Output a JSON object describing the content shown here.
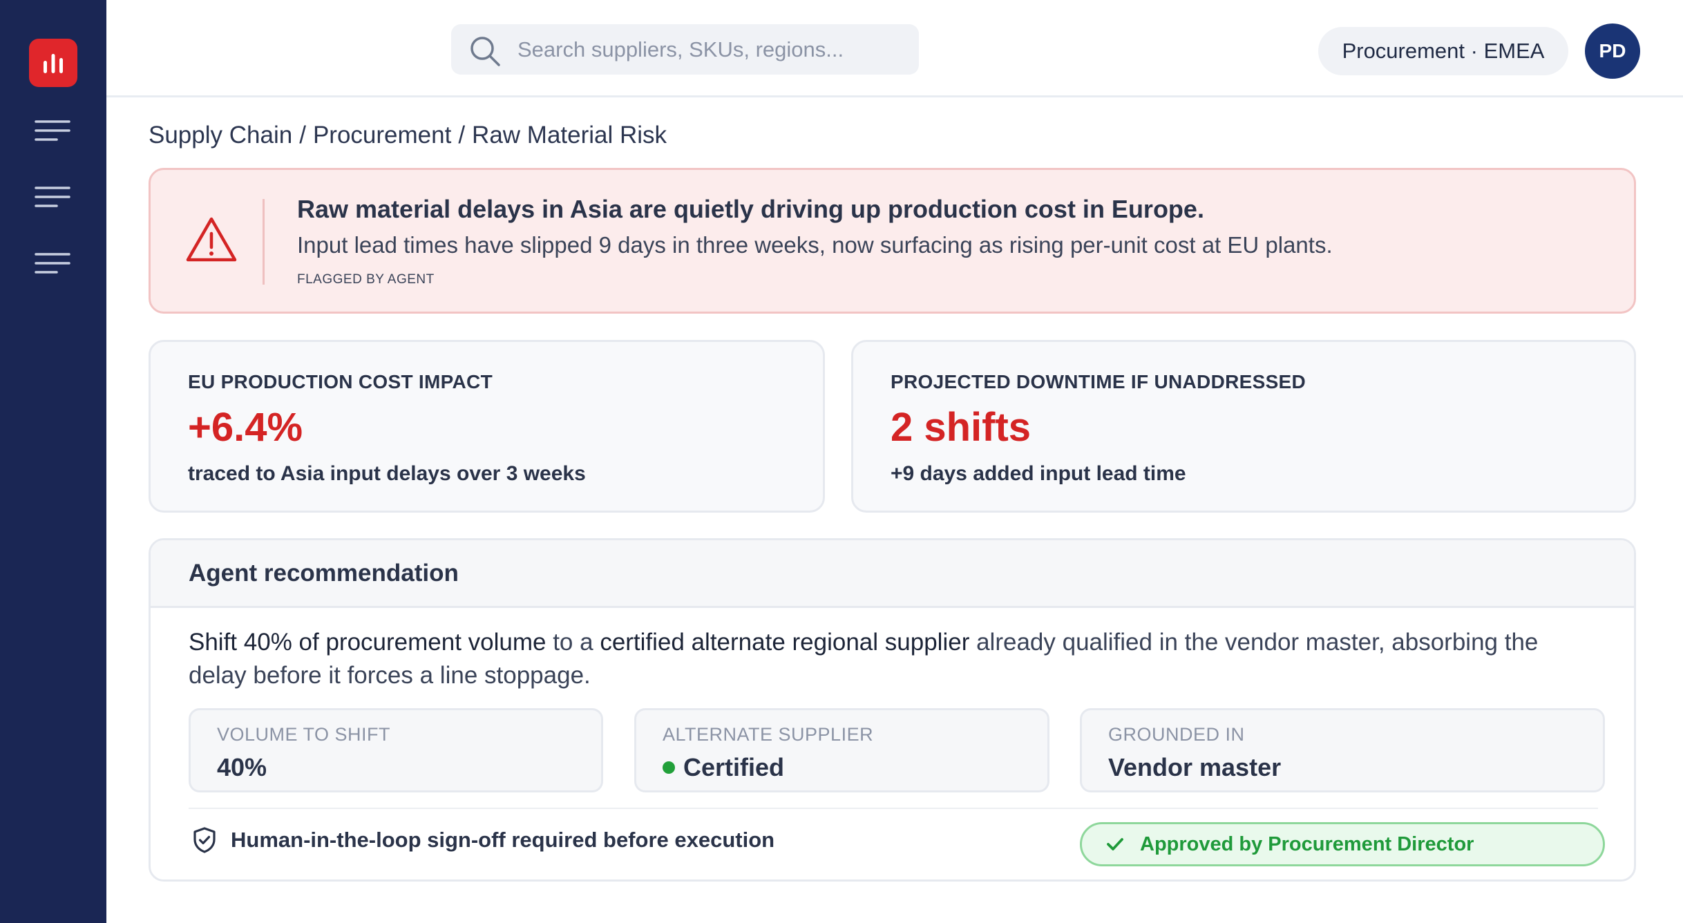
{
  "sidebar": {
    "logo": "bar-chart-icon",
    "nav_icons": [
      "menu-icon",
      "menu-icon",
      "menu-icon"
    ]
  },
  "topbar": {
    "search_placeholder": "Search suppliers, SKUs, regions...",
    "workspace": "Procurement · EMEA",
    "avatar_initials": "PD"
  },
  "breadcrumb": {
    "items": [
      "Supply Chain",
      "Procurement",
      "Raw Material Risk"
    ],
    "separator": "/"
  },
  "alert": {
    "title": "Raw material delays in Asia are quietly driving up production cost in Europe.",
    "subtitle": "Input lead times have slipped 9 days in three weeks, now surfacing as rising per-unit cost at EU plants.",
    "tag": "FLAGGED BY AGENT",
    "icon": "warning-triangle-icon"
  },
  "kpis": [
    {
      "label": "EU PRODUCTION COST IMPACT",
      "value": "+6.4%",
      "note": "traced to Asia input delays over 3 weeks"
    },
    {
      "label": "PROJECTED DOWNTIME IF UNADDRESSED",
      "value": "2 shifts",
      "note": "+9 days added input lead time"
    }
  ],
  "recommendation": {
    "title": "Agent recommendation",
    "body": {
      "p1": "Shift 40% of procurement volume",
      "p2": " to a ",
      "p3": "certified alternate regional supplier",
      "p4": " already qualified in the vendor master, absorbing the delay before it forces a line stoppage."
    },
    "chips": [
      {
        "label": "VOLUME TO SHIFT",
        "value": "40%"
      },
      {
        "label": "ALTERNATE SUPPLIER",
        "value": "Certified"
      },
      {
        "label": "GROUNDED IN",
        "value": "Vendor master"
      }
    ],
    "signoff": "Human-in-the-loop sign-off required before execution",
    "approved": "Approved by Procurement Director"
  },
  "colors": {
    "sidebar": "#1a2654",
    "accent_red": "#d42424",
    "success_green": "#1f9a3a"
  }
}
